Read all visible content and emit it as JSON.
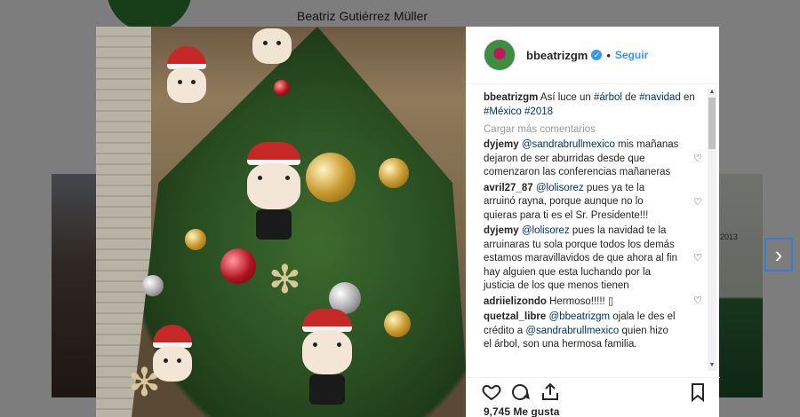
{
  "profile": {
    "display_name": "Beatriz Gutiérrez Müller",
    "bg_year": "2013"
  },
  "post": {
    "username": "bbeatrizgm",
    "follow_label": "Seguir",
    "dot": "•",
    "caption": {
      "user": "bbeatrizgm",
      "parts": [
        "Así luce un ",
        "#árbol",
        " de ",
        "#navidad",
        " en ",
        "#México",
        " ",
        "#2018"
      ]
    },
    "load_more": "Cargar más comentarios",
    "comments": [
      {
        "user": "dyjemy",
        "mention": "@sandrabrullmexico",
        "text": " mis mañanas dejaron de ser aburridas desde que comenzaron las conferencias mañaneras"
      },
      {
        "user": "avril27_87",
        "mention": "@lolisorez",
        "text": " pues ya te la arruinó rayna, porque aunque no lo quieras para ti es el Sr. Presidente!!!"
      },
      {
        "user": "dyjemy",
        "mention": "@lolisorez",
        "text": " pues la navidad te la arruinaras tu sola porque todos los demás estamos maravillavidos de que ahora al fin hay alguien que esta luchando por la justicia de los que menos tienen"
      },
      {
        "user": "adriielizondo",
        "mention": "",
        "text": "Hermoso!!!!! ▯"
      },
      {
        "user": "quetzal_libre",
        "mention": "@bbeatrizgm",
        "text": " ojala le des el crédito a ",
        "mention2": "@sandrabrullmexico",
        "text2": " quien hizo el árbol, son una hermosa familia."
      }
    ],
    "likes": "9,745 Me gusta"
  },
  "icons": {
    "heart": "heart-icon",
    "comment": "comment-icon",
    "share": "share-icon",
    "bookmark": "bookmark-icon",
    "next": "chevron-right-icon",
    "verified": "verified-badge-icon"
  },
  "colors": {
    "link": "#003569",
    "follow": "#3897f0",
    "text": "#262626",
    "muted": "#999999"
  }
}
